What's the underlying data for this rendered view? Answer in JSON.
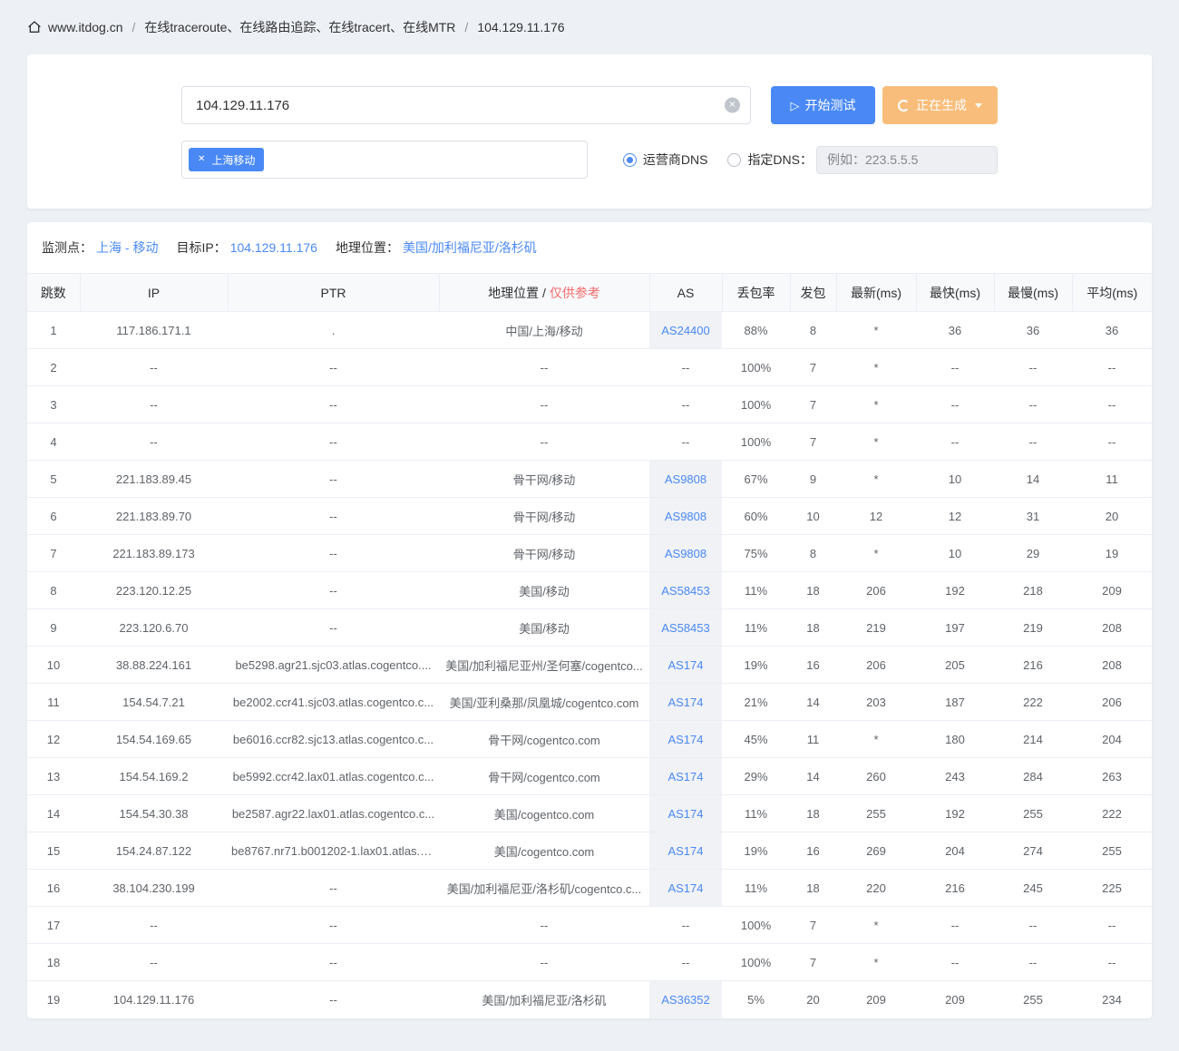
{
  "breadcrumb": {
    "home_site": "www.itdog.cn",
    "separator": "/",
    "section": "在线traceroute、在线路由追踪、在线tracert、在线MTR",
    "current": "104.129.11.176"
  },
  "form": {
    "target_value": "104.129.11.176",
    "start_button": "开始测试",
    "generating_button": "正在生成",
    "node_tag_label": "上海移动",
    "dns_carrier": "运营商DNS",
    "dns_custom": "指定DNS：",
    "dns_placeholder": "例如：223.5.5.5"
  },
  "result": {
    "monitor_label": "监测点：",
    "monitor_value": "上海 - 移动",
    "target_label": "目标IP：",
    "target_value": "104.129.11.176",
    "geo_label": "地理位置：",
    "geo_value": "美国/加利福尼亚/洛杉矶"
  },
  "table": {
    "headers": {
      "hop": "跳数",
      "ip": "IP",
      "ptr": "PTR",
      "geo_prefix": "地理位置 /",
      "geo_note": "仅供参考",
      "as": "AS",
      "loss": "丢包率",
      "sent": "发包",
      "latest": "最新(ms)",
      "fastest": "最快(ms)",
      "slowest": "最慢(ms)",
      "avg": "平均(ms)"
    },
    "rows": [
      {
        "hop": "1",
        "ip": "117.186.171.1",
        "ptr": ".",
        "geo": "中国/上海/移动",
        "as": "AS24400",
        "loss": "88%",
        "sent": "8",
        "latest": "*",
        "fastest": "36",
        "slowest": "36",
        "avg": "36"
      },
      {
        "hop": "2",
        "ip": "--",
        "ptr": "--",
        "geo": "--",
        "as": "--",
        "loss": "100%",
        "sent": "7",
        "latest": "*",
        "fastest": "--",
        "slowest": "--",
        "avg": "--"
      },
      {
        "hop": "3",
        "ip": "--",
        "ptr": "--",
        "geo": "--",
        "as": "--",
        "loss": "100%",
        "sent": "7",
        "latest": "*",
        "fastest": "--",
        "slowest": "--",
        "avg": "--"
      },
      {
        "hop": "4",
        "ip": "--",
        "ptr": "--",
        "geo": "--",
        "as": "--",
        "loss": "100%",
        "sent": "7",
        "latest": "*",
        "fastest": "--",
        "slowest": "--",
        "avg": "--"
      },
      {
        "hop": "5",
        "ip": "221.183.89.45",
        "ptr": "--",
        "geo": "骨干网/移动",
        "as": "AS9808",
        "loss": "67%",
        "sent": "9",
        "latest": "*",
        "fastest": "10",
        "slowest": "14",
        "avg": "11"
      },
      {
        "hop": "6",
        "ip": "221.183.89.70",
        "ptr": "--",
        "geo": "骨干网/移动",
        "as": "AS9808",
        "loss": "60%",
        "sent": "10",
        "latest": "12",
        "fastest": "12",
        "slowest": "31",
        "avg": "20"
      },
      {
        "hop": "7",
        "ip": "221.183.89.173",
        "ptr": "--",
        "geo": "骨干网/移动",
        "as": "AS9808",
        "loss": "75%",
        "sent": "8",
        "latest": "*",
        "fastest": "10",
        "slowest": "29",
        "avg": "19"
      },
      {
        "hop": "8",
        "ip": "223.120.12.25",
        "ptr": "--",
        "geo": "美国/移动",
        "as": "AS58453",
        "loss": "11%",
        "sent": "18",
        "latest": "206",
        "fastest": "192",
        "slowest": "218",
        "avg": "209"
      },
      {
        "hop": "9",
        "ip": "223.120.6.70",
        "ptr": "--",
        "geo": "美国/移动",
        "as": "AS58453",
        "loss": "11%",
        "sent": "18",
        "latest": "219",
        "fastest": "197",
        "slowest": "219",
        "avg": "208"
      },
      {
        "hop": "10",
        "ip": "38.88.224.161",
        "ptr": "be5298.agr21.sjc03.atlas.cogentco....",
        "geo": "美国/加利福尼亚州/圣何塞/cogentco...",
        "as": "AS174",
        "loss": "19%",
        "sent": "16",
        "latest": "206",
        "fastest": "205",
        "slowest": "216",
        "avg": "208"
      },
      {
        "hop": "11",
        "ip": "154.54.7.21",
        "ptr": "be2002.ccr41.sjc03.atlas.cogentco.c...",
        "geo": "美国/亚利桑那/凤凰城/cogentco.com",
        "as": "AS174",
        "loss": "21%",
        "sent": "14",
        "latest": "203",
        "fastest": "187",
        "slowest": "222",
        "avg": "206"
      },
      {
        "hop": "12",
        "ip": "154.54.169.65",
        "ptr": "be6016.ccr82.sjc13.atlas.cogentco.c...",
        "geo": "骨干网/cogentco.com",
        "as": "AS174",
        "loss": "45%",
        "sent": "11",
        "latest": "*",
        "fastest": "180",
        "slowest": "214",
        "avg": "204"
      },
      {
        "hop": "13",
        "ip": "154.54.169.2",
        "ptr": "be5992.ccr42.lax01.atlas.cogentco.c...",
        "geo": "骨干网/cogentco.com",
        "as": "AS174",
        "loss": "29%",
        "sent": "14",
        "latest": "260",
        "fastest": "243",
        "slowest": "284",
        "avg": "263"
      },
      {
        "hop": "14",
        "ip": "154.54.30.38",
        "ptr": "be2587.agr22.lax01.atlas.cogentco.c...",
        "geo": "美国/cogentco.com",
        "as": "AS174",
        "loss": "11%",
        "sent": "18",
        "latest": "255",
        "fastest": "192",
        "slowest": "255",
        "avg": "222"
      },
      {
        "hop": "15",
        "ip": "154.24.87.122",
        "ptr": "be8767.nr71.b001202-1.lax01.atlas.c...",
        "geo": "美国/cogentco.com",
        "as": "AS174",
        "loss": "19%",
        "sent": "16",
        "latest": "269",
        "fastest": "204",
        "slowest": "274",
        "avg": "255"
      },
      {
        "hop": "16",
        "ip": "38.104.230.199",
        "ptr": "--",
        "geo": "美国/加利福尼亚/洛杉矶/cogentco.c...",
        "as": "AS174",
        "loss": "11%",
        "sent": "18",
        "latest": "220",
        "fastest": "216",
        "slowest": "245",
        "avg": "225"
      },
      {
        "hop": "17",
        "ip": "--",
        "ptr": "--",
        "geo": "--",
        "as": "--",
        "loss": "100%",
        "sent": "7",
        "latest": "*",
        "fastest": "--",
        "slowest": "--",
        "avg": "--"
      },
      {
        "hop": "18",
        "ip": "--",
        "ptr": "--",
        "geo": "--",
        "as": "--",
        "loss": "100%",
        "sent": "7",
        "latest": "*",
        "fastest": "--",
        "slowest": "--",
        "avg": "--"
      },
      {
        "hop": "19",
        "ip": "104.129.11.176",
        "ptr": "--",
        "geo": "美国/加利福尼亚/洛杉矶",
        "as": "AS36352",
        "loss": "5%",
        "sent": "20",
        "latest": "209",
        "fastest": "209",
        "slowest": "255",
        "avg": "234"
      }
    ]
  },
  "colors": {
    "primary_blue": "#4a89f5",
    "warning_orange": "#f9bd7b",
    "danger_red": "#f56c6c",
    "page_background": "#edf0f4",
    "table_header_bg": "#f8f9fb",
    "border": "#ebeef5"
  }
}
